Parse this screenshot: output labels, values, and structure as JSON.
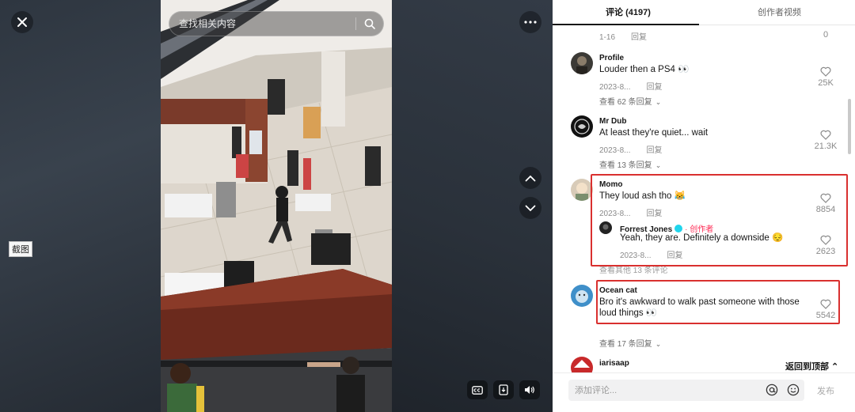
{
  "stage": {
    "screenshot_tag": "截图"
  },
  "video": {
    "search_placeholder": "查找相关内容"
  },
  "panel": {
    "tabs": [
      {
        "label": "评论 (4197)",
        "active": true
      },
      {
        "label": "创作者视频",
        "active": false
      }
    ],
    "top_partial": {
      "date": "1-16",
      "reply": "回复",
      "likes": "0"
    },
    "comments": [
      {
        "user": "Profile",
        "text": "Louder then a PS4 👀",
        "date": "2023-8...",
        "reply": "回复",
        "likes": "25K",
        "view_replies": "查看 62 条回复"
      },
      {
        "user": "Mr Dub",
        "text": "At least they're quiet... wait",
        "date": "2023-8...",
        "reply": "回复",
        "likes": "21.3K",
        "view_replies": "查看 13 条回复"
      },
      {
        "user": "Momo",
        "text": "They loud ash tho 😹",
        "date": "2023-8...",
        "reply": "回复",
        "likes": "8854",
        "reply_item": {
          "user": "Forrest Jones",
          "author_tag": "· 创作者",
          "text": "Yeah, they are. Definitely a downside 😔",
          "date": "2023-8...",
          "reply": "回复",
          "likes": "2623"
        },
        "view_replies": "查看其他 13 条评论"
      },
      {
        "user": "Ocean cat",
        "text_line1": "Bro it's awkward to walk past someone with those",
        "text_line2": "loud things 👀",
        "likes": "5542",
        "view_replies": "查看 17 条回复"
      },
      {
        "user": "iarisaap"
      }
    ],
    "back_to_top": "返回到顶部 ⌃",
    "composer": {
      "placeholder": "添加评论...",
      "post": "发布"
    }
  },
  "colors": {
    "highlight": "#d9302f",
    "creator_tag": "#fe2c55",
    "verified": "#20d5ec"
  }
}
